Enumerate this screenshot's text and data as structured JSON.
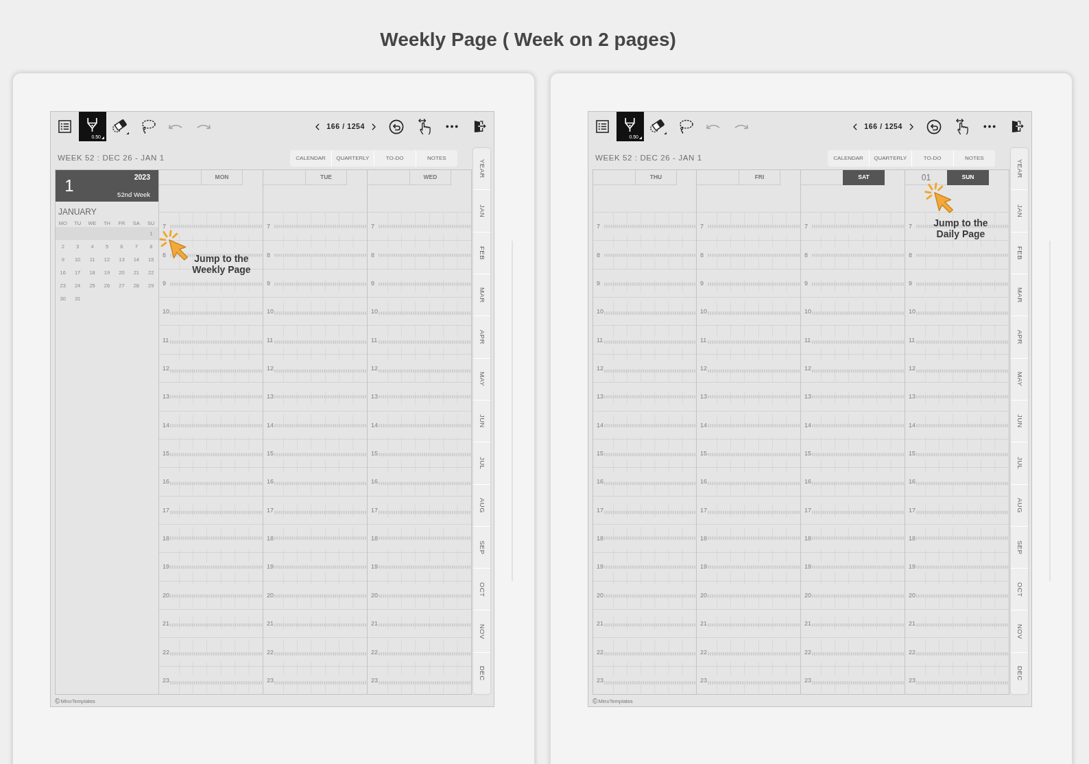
{
  "title": "Weekly Page ( Week on 2 pages)",
  "pages": [
    {
      "toolbar": {
        "pen": {
          "selected": true,
          "size": "0.50"
        },
        "undo": {
          "disabled": true
        },
        "redo": {
          "disabled": true
        },
        "page_indicator": "166 / 1254"
      },
      "week_title": "WEEK 52 : DEC 26 - JAN 1",
      "tabs": [
        {
          "label": "CALENDAR",
          "selected": false
        },
        {
          "label": "QUARTERLY",
          "selected": false
        },
        {
          "label": "TO-DO",
          "selected": false
        },
        {
          "label": "NOTES",
          "selected": false
        }
      ],
      "sidebar": {
        "day_number": "1",
        "year": "2023",
        "week_label": "52nd Week",
        "month": "JANUARY",
        "weekdays": [
          "MO",
          "TU",
          "WE",
          "TH",
          "FR",
          "SA",
          "SU"
        ],
        "weeks": [
          {
            "selected": true,
            "days": {
              "su": "1"
            }
          },
          {
            "selected": false,
            "days": {
              "mo": "2",
              "tu": "3",
              "we": "4",
              "th": "5",
              "fr": "6",
              "sa": "7",
              "su": "8"
            }
          },
          {
            "selected": false,
            "days": {
              "mo": "9",
              "tu": "10",
              "we": "11",
              "th": "12",
              "fr": "13",
              "sa": "14",
              "su": "15"
            }
          },
          {
            "selected": false,
            "days": {
              "mo": "16",
              "tu": "17",
              "we": "18",
              "th": "19",
              "fr": "20",
              "sa": "21",
              "su": "22"
            }
          },
          {
            "selected": false,
            "days": {
              "mo": "23",
              "tu": "24",
              "we": "25",
              "th": "26",
              "fr": "27",
              "sa": "28",
              "su": "29"
            }
          },
          {
            "selected": false,
            "days": {
              "mo": "30",
              "tu": "31"
            }
          }
        ],
        "callout": {
          "text": "Jump to the Weekly Page"
        }
      },
      "days": [
        {
          "label": "MON",
          "highlighted": false,
          "hours": [
            "7",
            "8",
            "9",
            "10",
            "11",
            "12",
            "13",
            "14",
            "15",
            "16",
            "17",
            "18",
            "19",
            "20",
            "21",
            "22",
            "23"
          ]
        },
        {
          "label": "TUE",
          "highlighted": false,
          "hours": [
            "7",
            "8",
            "9",
            "10",
            "11",
            "12",
            "13",
            "14",
            "15",
            "16",
            "17",
            "18",
            "19",
            "20",
            "21",
            "22",
            "23"
          ]
        },
        {
          "label": "WED",
          "highlighted": false,
          "hours": [
            "7",
            "8",
            "9",
            "10",
            "11",
            "12",
            "13",
            "14",
            "15",
            "16",
            "17",
            "18",
            "19",
            "20",
            "21",
            "22",
            "23"
          ]
        }
      ],
      "month_tabs": [
        "YEAR",
        "JAN",
        "FEB",
        "MAR",
        "APR",
        "MAY",
        "JUN",
        "JUL",
        "AUG",
        "SEP",
        "OCT",
        "NOV",
        "DEC"
      ],
      "footer": {
        "symbol": "©",
        "text": "MinoTemplates"
      }
    },
    {
      "toolbar": {
        "pen": {
          "selected": true,
          "size": "0.50"
        },
        "undo": {
          "disabled": true
        },
        "redo": {
          "disabled": true
        },
        "page_indicator": "166 / 1254"
      },
      "week_title": "WEEK 52 : DEC 26 - JAN 1",
      "tabs": [
        {
          "label": "CALENDAR",
          "selected": false
        },
        {
          "label": "QUARTERLY",
          "selected": false
        },
        {
          "label": "TO-DO",
          "selected": false
        },
        {
          "label": "NOTES",
          "selected": false
        }
      ],
      "days": [
        {
          "label": "THU",
          "highlighted": false,
          "hours": [
            "7",
            "8",
            "9",
            "10",
            "11",
            "12",
            "13",
            "14",
            "15",
            "16",
            "17",
            "18",
            "19",
            "20",
            "21",
            "22",
            "23"
          ]
        },
        {
          "label": "FRI",
          "highlighted": false,
          "hours": [
            "7",
            "8",
            "9",
            "10",
            "11",
            "12",
            "13",
            "14",
            "15",
            "16",
            "17",
            "18",
            "19",
            "20",
            "21",
            "22",
            "23"
          ]
        },
        {
          "label": "SAT",
          "highlighted": true,
          "hours": [
            "7",
            "8",
            "9",
            "10",
            "11",
            "12",
            "13",
            "14",
            "15",
            "16",
            "17",
            "18",
            "19",
            "20",
            "21",
            "22",
            "23"
          ]
        },
        {
          "label": "SUN",
          "date": "01",
          "highlighted": true,
          "hours": [
            "7",
            "8",
            "9",
            "10",
            "11",
            "12",
            "13",
            "14",
            "15",
            "16",
            "17",
            "18",
            "19",
            "20",
            "21",
            "22",
            "23"
          ],
          "callout": {
            "text": "Jump to the Daily Page"
          }
        }
      ],
      "month_tabs": [
        "YEAR",
        "JAN",
        "FEB",
        "MAR",
        "APR",
        "MAY",
        "JUN",
        "JUL",
        "AUG",
        "SEP",
        "OCT",
        "NOV",
        "DEC"
      ],
      "footer": {
        "symbol": "©",
        "text": "MinoTemplates"
      }
    }
  ]
}
